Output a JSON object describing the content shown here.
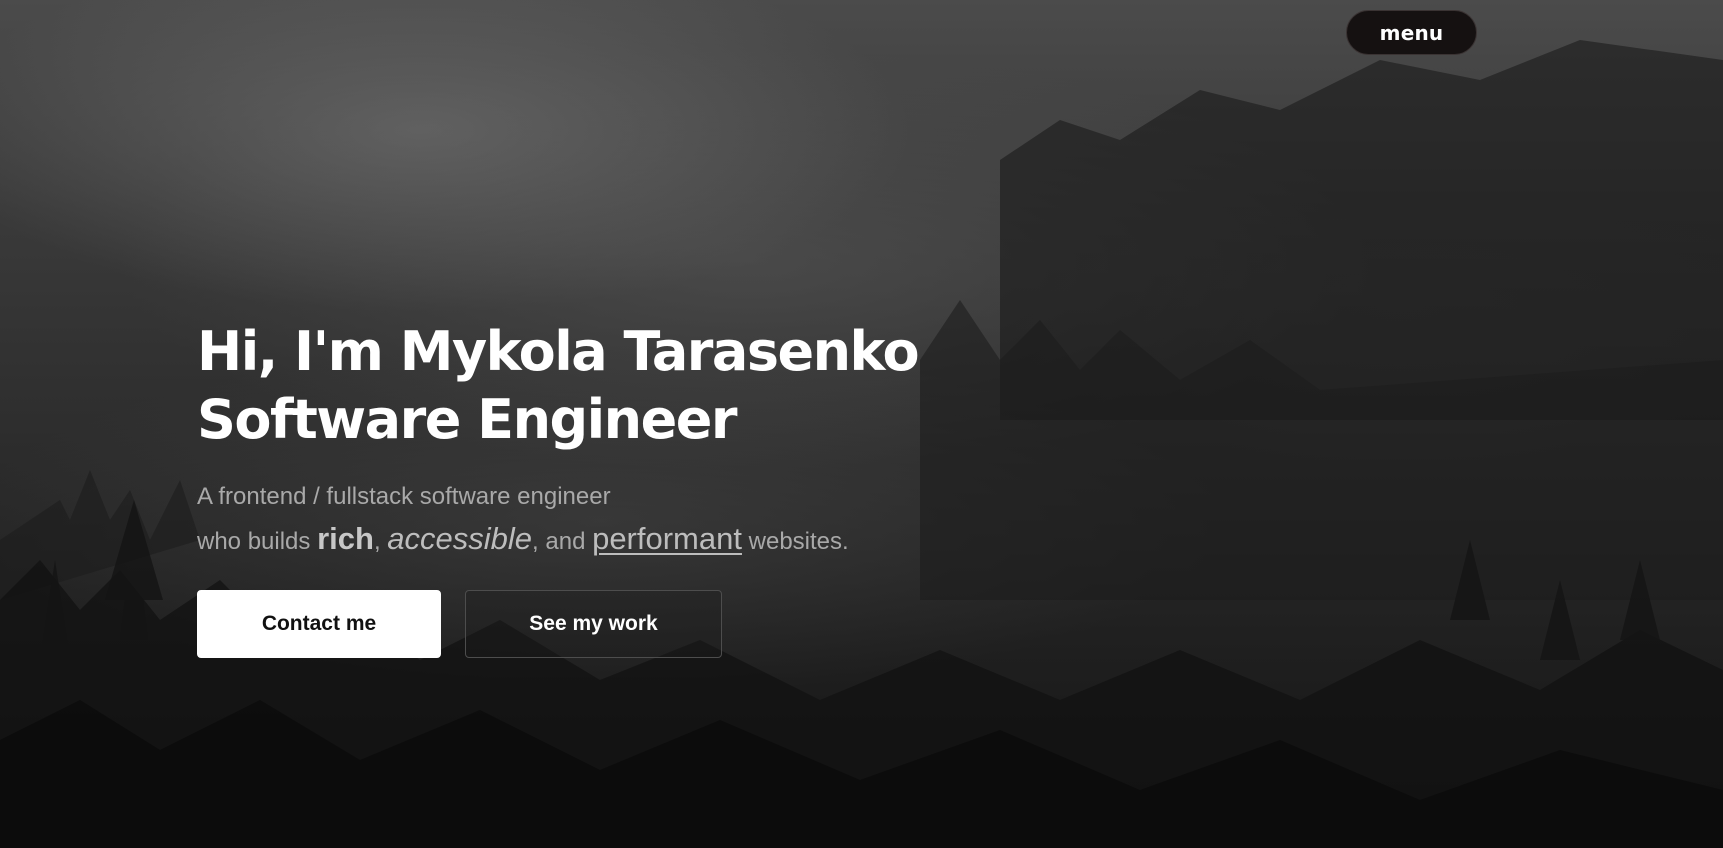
{
  "header": {
    "menu_label": "menu"
  },
  "hero": {
    "title_line1": "Hi, I'm Mykola Tarasenko",
    "title_line2": "Software Engineer",
    "subtitle_line1": "A frontend / fullstack software engineer",
    "subtitle_prefix": "who builds ",
    "word_rich": "rich",
    "sep1": ", ",
    "word_accessible": "accessible",
    "sep2": ", and ",
    "word_performant": "performant",
    "subtitle_suffix": " websites."
  },
  "actions": {
    "contact_label": "Contact me",
    "work_label": "See my work"
  },
  "colors": {
    "background": "#1a1a1a",
    "text_primary": "#ffffff",
    "text_secondary": "#a9a9a9",
    "menu_background": "#151111"
  }
}
